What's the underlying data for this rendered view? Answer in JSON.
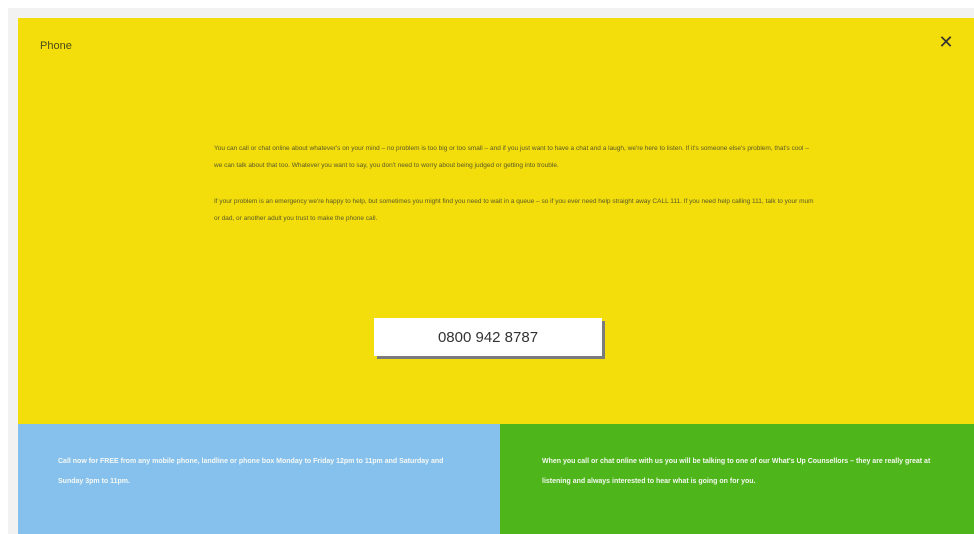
{
  "modal": {
    "title": "Phone",
    "close_label": "✕",
    "paragraphs": [
      "You can call or chat online about whatever's on your mind – no problem is too big or too small – and if you just want to have a chat and a laugh, we're here to listen. If it's someone else's problem, that's cool – we can talk about that too. Whatever you want to say, you don't need to worry about being judged or getting into trouble.",
      "If your problem is an emergency we're happy to help, but sometimes you might find you need to wait in a queue – so if you ever need help straight away CALL 111. If you need help calling 111, talk to your mum or dad, or another adult you trust to make the phone call."
    ],
    "phone_number": "0800 942 8787"
  },
  "footer": {
    "left_text": "Call now for FREE from any mobile phone, landline or phone box Monday to Friday 12pm to 11pm and Saturday and Sunday 3pm to 11pm.",
    "right_text": "When you call or chat online with us you will be talking to one of our What's Up Counsellors – they are really great at listening and always interested to hear what is going on for you."
  },
  "colors": {
    "main_panel": "#f3dd0b",
    "left_panel": "#86c1ee",
    "right_panel": "#4eb61a"
  },
  "icons": {
    "close": "close-icon"
  }
}
